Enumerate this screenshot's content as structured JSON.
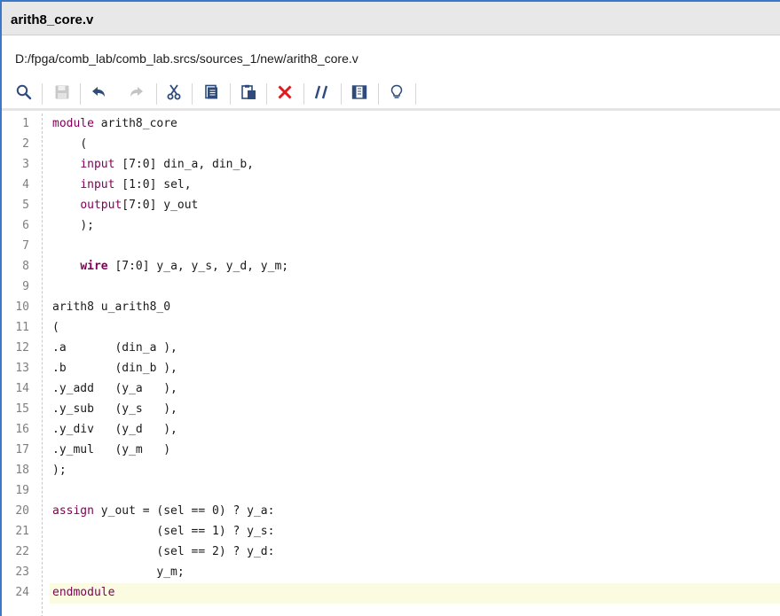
{
  "window": {
    "title": "arith8_core.v"
  },
  "path": {
    "text": "D:/fpga/comb_lab/comb_lab.srcs/sources_1/new/arith8_core.v"
  },
  "toolbar": {
    "buttons": [
      {
        "name": "search-icon"
      },
      {
        "name": "save-icon"
      },
      {
        "name": "undo-icon"
      },
      {
        "name": "redo-icon"
      },
      {
        "name": "cut-icon"
      },
      {
        "name": "copy-icon"
      },
      {
        "name": "paste-icon"
      },
      {
        "name": "delete-icon"
      },
      {
        "name": "comment-toggle-icon"
      },
      {
        "name": "columns-icon"
      },
      {
        "name": "lightbulb-icon"
      }
    ]
  },
  "colors": {
    "keyword": "#7f0055",
    "current_line": "#fbfbe1",
    "title_accent": "#3b78c9"
  },
  "editor": {
    "current_line": 24,
    "lines": [
      {
        "n": "1",
        "kw": "module",
        "rest": " arith8_core",
        "indent": ""
      },
      {
        "n": "2",
        "kw": "",
        "rest": "(",
        "indent": "    "
      },
      {
        "n": "3",
        "kw": "input",
        "rest": " [7:0] din_a, din_b,",
        "indent": "    "
      },
      {
        "n": "4",
        "kw": "input",
        "rest": " [1:0] sel,",
        "indent": "    "
      },
      {
        "n": "5",
        "kw": "output",
        "rest": "[7:0] y_out",
        "indent": "    "
      },
      {
        "n": "6",
        "kw": "",
        "rest": ");",
        "indent": "    "
      },
      {
        "n": "7",
        "kw": "",
        "rest": "",
        "indent": ""
      },
      {
        "n": "8",
        "kwb": "wire",
        "rest": " [7:0] y_a, y_s, y_d, y_m;",
        "indent": "    "
      },
      {
        "n": "9",
        "kw": "",
        "rest": "",
        "indent": ""
      },
      {
        "n": "10",
        "kw": "",
        "rest": "arith8 u_arith8_0",
        "indent": ""
      },
      {
        "n": "11",
        "kw": "",
        "rest": "(",
        "indent": ""
      },
      {
        "n": "12",
        "kw": "",
        "rest": ".a       (din_a ),",
        "indent": ""
      },
      {
        "n": "13",
        "kw": "",
        "rest": ".b       (din_b ),",
        "indent": ""
      },
      {
        "n": "14",
        "kw": "",
        "rest": ".y_add   (y_a   ),",
        "indent": ""
      },
      {
        "n": "15",
        "kw": "",
        "rest": ".y_sub   (y_s   ),",
        "indent": ""
      },
      {
        "n": "16",
        "kw": "",
        "rest": ".y_div   (y_d   ),",
        "indent": ""
      },
      {
        "n": "17",
        "kw": "",
        "rest": ".y_mul   (y_m   )",
        "indent": ""
      },
      {
        "n": "18",
        "kw": "",
        "rest": ");",
        "indent": ""
      },
      {
        "n": "19",
        "kw": "",
        "rest": "",
        "indent": ""
      },
      {
        "n": "20",
        "kw": "assign",
        "rest": " y_out = (sel == 0) ? y_a:",
        "indent": ""
      },
      {
        "n": "21",
        "kw": "",
        "rest": "(sel == 1) ? y_s:",
        "indent": "               "
      },
      {
        "n": "22",
        "kw": "",
        "rest": "(sel == 2) ? y_d:",
        "indent": "               "
      },
      {
        "n": "23",
        "kw": "",
        "rest": "y_m;",
        "indent": "               "
      },
      {
        "n": "24",
        "kw": "endmodule",
        "rest": "",
        "indent": ""
      }
    ]
  }
}
